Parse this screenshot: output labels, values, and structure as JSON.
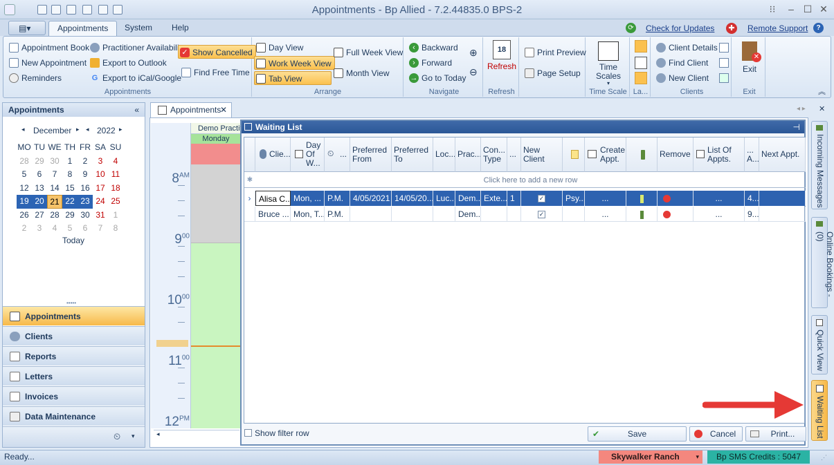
{
  "window": {
    "title": "Appointments - Bp Allied - 7.2.44835.0  BPS-2"
  },
  "ribbon_tabs": [
    "Appointments",
    "System",
    "Help"
  ],
  "top_links": {
    "check_updates": "Check for Updates",
    "remote_support": "Remote Support"
  },
  "ribbon": {
    "appointments_group": {
      "label": "Appointments",
      "appointment_book": "Appointment Book",
      "new_appointment": "New Appointment",
      "reminders": "Reminders",
      "practitioner_availability": "Practitioner Availability",
      "export_outlook": "Export to Outlook",
      "export_ical": "Export to iCal/Google",
      "show_cancelled": "Show Cancelled",
      "find_free_time": "Find Free Time"
    },
    "arrange_group": {
      "label": "Arrange",
      "day_view": "Day View",
      "work_week_view": "Work Week View",
      "tab_view": "Tab View",
      "full_week_view": "Full Week View",
      "month_view": "Month View"
    },
    "navigate_group": {
      "label": "Navigate",
      "backward": "Backward",
      "forward": "Forward",
      "go_to_today": "Go to Today"
    },
    "refresh_group": {
      "label": "Refresh",
      "refresh": "Refresh",
      "cal_num": "18"
    },
    "print_group": {
      "print_preview": "Print Preview",
      "page_setup": "Page Setup"
    },
    "timescale_group": {
      "label": "Time Scale",
      "time_scales": "Time Scales"
    },
    "layout_group": {
      "label": "La..."
    },
    "clients_group": {
      "label": "Clients",
      "client_details": "Client Details",
      "find_client": "Find Client",
      "new_client": "New Client"
    },
    "exit_group": {
      "label": "Exit",
      "exit": "Exit"
    }
  },
  "left_pane": {
    "title": "Appointments",
    "calendar": {
      "month": "December",
      "year": "2022",
      "weekdays": [
        "MO",
        "TU",
        "WE",
        "TH",
        "FR",
        "SA",
        "SU"
      ],
      "weeks": [
        [
          "28",
          "29",
          "30",
          "1",
          "2",
          "3",
          "4"
        ],
        [
          "5",
          "6",
          "7",
          "8",
          "9",
          "10",
          "11"
        ],
        [
          "12",
          "13",
          "14",
          "15",
          "16",
          "17",
          "18"
        ],
        [
          "19",
          "20",
          "21",
          "22",
          "23",
          "24",
          "25"
        ],
        [
          "26",
          "27",
          "28",
          "29",
          "30",
          "31",
          "1"
        ],
        [
          "2",
          "3",
          "4",
          "5",
          "6",
          "7",
          "8"
        ]
      ],
      "today_label": "Today"
    },
    "nav": [
      "Appointments",
      "Clients",
      "Reports",
      "Letters",
      "Invoices",
      "Data Maintenance"
    ]
  },
  "doc_tab": "Appointments",
  "scheduler": {
    "column_title": "Demo Practiti",
    "day": "Monday",
    "hours": [
      {
        "h": "8",
        "s": "AM"
      },
      {
        "h": "9",
        "s": "00"
      },
      {
        "h": "10",
        "s": "00"
      },
      {
        "h": "11",
        "s": "00"
      },
      {
        "h": "12",
        "s": "PM"
      }
    ]
  },
  "waiting_list": {
    "title": "Waiting List",
    "columns": [
      "Clie...",
      "Day Of W...",
      "...",
      "Preferred From",
      "Preferred To",
      "Loc...",
      "Prac...",
      "Con... Type",
      "...",
      "New Client",
      "",
      "Create Appt.",
      "",
      "Remove",
      "List Of Appts.",
      "... A...",
      "Next Appt."
    ],
    "add_row": "Click here to add a new row",
    "rows": [
      {
        "client": "Alisa C...",
        "day": "Mon, ...",
        "time": "P.M.",
        "pref_from": "4/05/2021",
        "pref_to": "14/05/20...",
        "loc": "Luc...",
        "prac": "Dem...",
        "type": "Exte...",
        "num": "1",
        "new_client": true,
        "note": "Psy...",
        "create": "...",
        "list": "...",
        "extra": "4...",
        "selected": true
      },
      {
        "client": "Bruce ...",
        "day": "Mon, T...",
        "time": "P.M.",
        "pref_from": "",
        "pref_to": "",
        "loc": "",
        "prac": "Dem...",
        "type": "",
        "num": "",
        "new_client": true,
        "note": "",
        "create": "...",
        "list": "...",
        "extra": "9...",
        "selected": false
      }
    ],
    "show_filter": "Show filter row",
    "save": "Save",
    "cancel": "Cancel",
    "print": "Print..."
  },
  "side_tabs": [
    "Incoming Messages",
    "Online Bookings - (0)",
    "Quick View",
    "Waiting List"
  ],
  "status": {
    "ready": "Ready...",
    "location": "Skywalker Ranch",
    "sms": "Bp SMS Credits : 5047"
  },
  "colors": {
    "highlight": "#f7b94a",
    "selection": "#2d62b0",
    "arrow": "#e53935",
    "location_bg": "#f4877e",
    "sms_bg": "#2bb3a4"
  }
}
